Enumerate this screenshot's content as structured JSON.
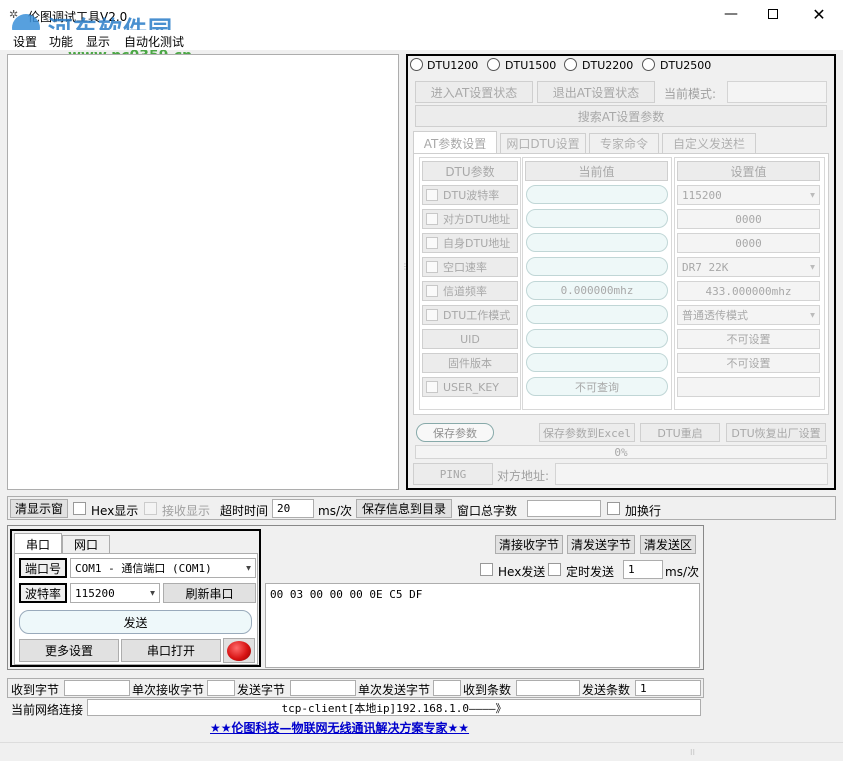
{
  "window": {
    "title": "伦图调试工具V2.0",
    "watermark_name": "河东软件园",
    "watermark_url": "www.pc0359.cn"
  },
  "menu": [
    "设置",
    "功能",
    "显示",
    "自动化测试"
  ],
  "dtu_radios": [
    "DTU1200",
    "DTU1500",
    "DTU2200",
    "DTU2500"
  ],
  "at": {
    "enter_label": "进入AT设置状态",
    "exit_label": "退出AT设置状态",
    "mode_label": "当前模式:",
    "search_label": "搜索AT设置参数"
  },
  "tabs": [
    "AT参数设置",
    "网口DTU设置",
    "专家命令",
    "自定义发送栏"
  ],
  "param_table": {
    "headers": [
      "DTU参数",
      "当前值",
      "设置值"
    ],
    "rows": [
      {
        "label": "DTU波特率",
        "checkbox": true,
        "current": "",
        "set": "115200",
        "set_type": "dropdown"
      },
      {
        "label": "对方DTU地址",
        "checkbox": true,
        "current": "",
        "set": "0000",
        "set_type": "field"
      },
      {
        "label": "自身DTU地址",
        "checkbox": true,
        "current": "",
        "set": "0000",
        "set_type": "field"
      },
      {
        "label": "空口速率",
        "checkbox": true,
        "current": "",
        "set": "DR7    22K",
        "set_type": "dropdown"
      },
      {
        "label": "信道频率",
        "checkbox": true,
        "current": "0.000000mhz",
        "set": "433.000000mhz",
        "set_type": "field"
      },
      {
        "label": "DTU工作模式",
        "checkbox": true,
        "current": "",
        "set": "普通透传模式",
        "set_type": "dropdown"
      },
      {
        "label": "UID",
        "checkbox": false,
        "current": "",
        "set": "不可设置",
        "set_type": "field"
      },
      {
        "label": "固件版本",
        "checkbox": false,
        "current": "",
        "set": "不可设置",
        "set_type": "field"
      },
      {
        "label": "USER_KEY",
        "checkbox": true,
        "current": "不可查询",
        "set": "",
        "set_type": "field"
      }
    ]
  },
  "param_actions": {
    "save": "保存参数",
    "save_excel": "保存参数到Excel",
    "restart": "DTU重启",
    "factory": "DTU恢复出厂设置",
    "progress": "0%",
    "progress_value": 0,
    "ping": "PING",
    "peer_label": "对方地址:"
  },
  "toolbar": {
    "clear_display": "清显示窗",
    "hex_display": "Hex显示",
    "recv_display": "接收显示",
    "timeout_label": "超时时间",
    "timeout_value": "20",
    "timeout_unit": "ms/次",
    "save_info": "保存信息到目录",
    "window_total": "窗口总字数",
    "wrap": "加换行"
  },
  "serial": {
    "tab_serial": "串口",
    "tab_net": "网口",
    "port_label": "端口号",
    "port_value": "COM1 - 通信端口 (COM1)",
    "baud_label": "波特率",
    "baud_value": "115200",
    "refresh": "刷新串口",
    "send": "发送",
    "more": "更多设置",
    "open": "串口打开"
  },
  "send_area": {
    "clear_recv": "清接收字节",
    "clear_send": "清发送字节",
    "clear_area": "清发送区",
    "hex_send": "Hex发送",
    "timed_send": "定时发送",
    "interval_value": "1",
    "interval_unit": "ms/次",
    "content": "00 03 00 00 00 0E C5 DF"
  },
  "status": {
    "recv_bytes": "收到字节",
    "single_recv": "单次接收字节",
    "send_bytes": "发送字节",
    "single_send": "单次发送字节",
    "recv_count": "收到条数",
    "send_count": "发送条数",
    "send_count_value": "1",
    "net_label": "当前网络连接",
    "net_value": "tcp-client[本地ip]192.168.1.0————》",
    "footer": "★★伦图科技—物联网无线通讯解决方案专家★★"
  },
  "colors": {
    "led": "#d81414",
    "footer_link": "#0000cc",
    "watermark": "#2a7dc8"
  }
}
